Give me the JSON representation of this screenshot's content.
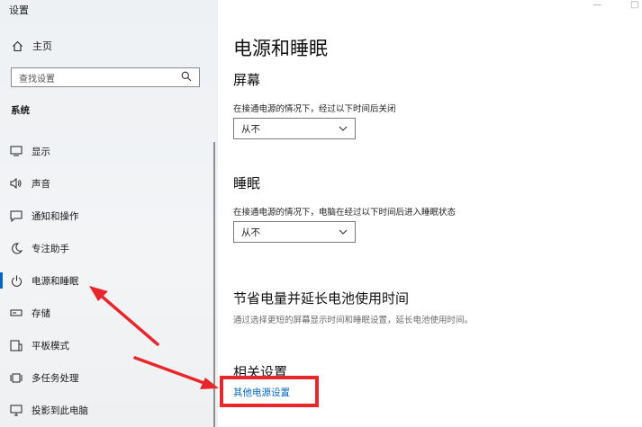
{
  "window": {
    "title": "设置"
  },
  "sidebar": {
    "home_label": "主页",
    "search": {
      "placeholder": "查找设置"
    },
    "section_label": "系统",
    "items": [
      {
        "label": "显示",
        "icon": "display-icon"
      },
      {
        "label": "声音",
        "icon": "speaker-icon"
      },
      {
        "label": "通知和操作",
        "icon": "notification-icon"
      },
      {
        "label": "专注助手",
        "icon": "moon-icon"
      },
      {
        "label": "电源和睡眠",
        "icon": "power-icon",
        "active": true
      },
      {
        "label": "存储",
        "icon": "storage-icon"
      },
      {
        "label": "平板模式",
        "icon": "tablet-icon"
      },
      {
        "label": "多任务处理",
        "icon": "multitask-icon"
      },
      {
        "label": "投影到此电脑",
        "icon": "project-icon"
      }
    ]
  },
  "main": {
    "title": "电源和睡眠",
    "screen": {
      "heading": "屏幕",
      "desc": "在接通电源的情况下，经过以下时间后关闭",
      "value": "从不"
    },
    "sleep": {
      "heading": "睡眠",
      "desc": "在接通电源的情况下，电脑在经过以下时间后进入睡眠状态",
      "value": "从不"
    },
    "battery": {
      "heading": "节省电量并延长电池使用时间",
      "desc": "通过选择更短的屏幕显示时间和睡眠设置，延长电池使用时间。"
    },
    "related": {
      "heading": "相关设置",
      "link": "其他电源设置"
    }
  },
  "colors": {
    "accent": "#0067c0",
    "annotation": "#e8272c"
  }
}
